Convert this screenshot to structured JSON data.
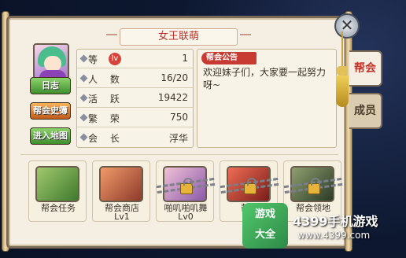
{
  "window": {
    "title": "女王联萌",
    "close_symbol": "✕"
  },
  "sidebar": {
    "buttons": [
      {
        "label": "日志"
      },
      {
        "label": "帮会史簿"
      },
      {
        "label": "进入地图"
      }
    ]
  },
  "guild_info": {
    "level_label": "等 级",
    "level_badge": "lv",
    "level_value": "1",
    "members_label": "人 数",
    "members_value": "16/20",
    "activity_label": "活 跃",
    "activity_value": "19422",
    "prosperity_label": "繁 荣",
    "prosperity_value": "750",
    "leader_label": "会 长",
    "leader_value": "浮华"
  },
  "notice": {
    "tag": "帮会公告",
    "text": "欢迎妹子们，大家要一起努力呀~"
  },
  "tabs": [
    {
      "label": "帮会"
    },
    {
      "label": "成员"
    }
  ],
  "features": [
    {
      "line1": "帮会任务",
      "line2": "",
      "locked": false
    },
    {
      "line1": "帮会商店",
      "line2": "Lv1",
      "locked": false
    },
    {
      "line1": "啪叽啪叽舞",
      "line2": "Lv0",
      "locked": true
    },
    {
      "line1": "帮会",
      "line2": "",
      "locked": true
    },
    {
      "line1": "帮会领地",
      "line2": "",
      "locked": true
    }
  ],
  "watermark": {
    "logo_line1": "游戏",
    "logo_line2": "大全",
    "brand": "4399手机游戏",
    "url": "www.4399.com"
  }
}
